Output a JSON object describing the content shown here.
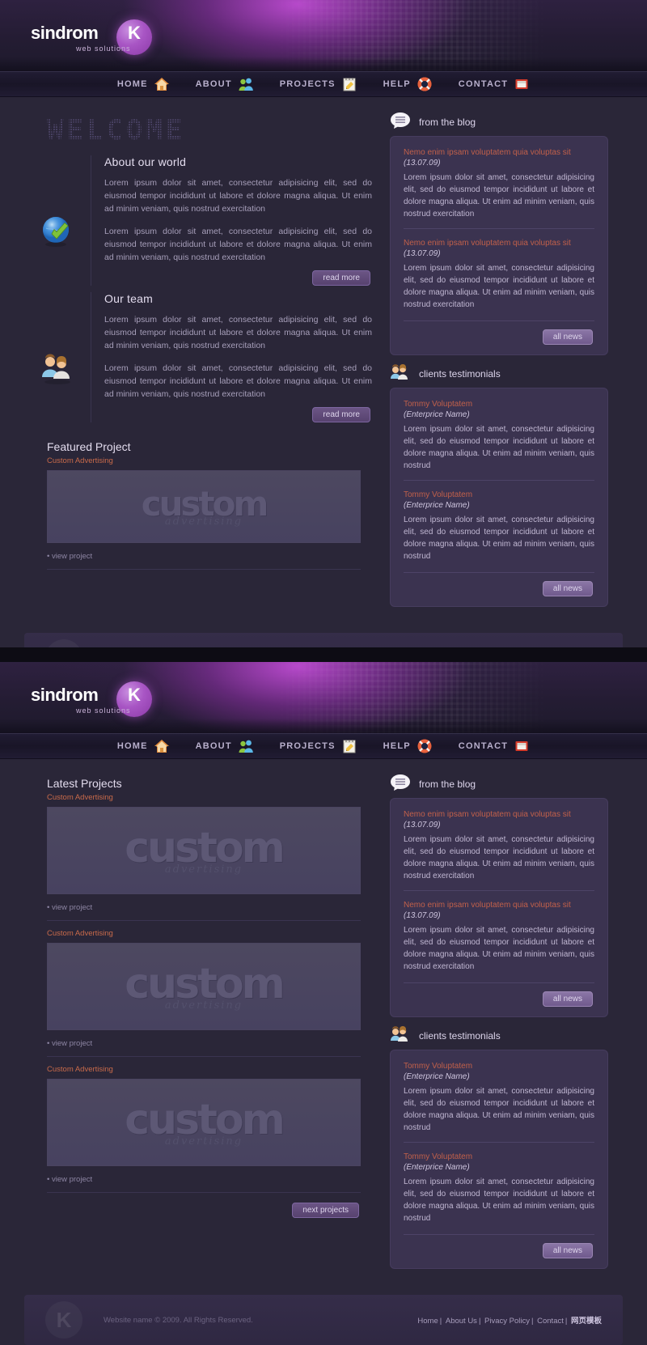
{
  "brand": {
    "name": "sindrom",
    "mark": "K",
    "tagline": "web solutions"
  },
  "nav": [
    {
      "label": "HOME",
      "icon": "house-icon"
    },
    {
      "label": "ABOUT",
      "icon": "users-icon"
    },
    {
      "label": "PROJECTS",
      "icon": "notepad-icon"
    },
    {
      "label": "HELP",
      "icon": "lifebuoy-icon"
    },
    {
      "label": "CONTACT",
      "icon": "mailbox-icon"
    }
  ],
  "home": {
    "welcome_title": "WELCOME",
    "blocks": [
      {
        "icon": "globe-check-icon",
        "heading": "About our world",
        "paragraphs": [
          "Lorem ipsum dolor sit amet, consectetur adipisicing elit, sed do eiusmod tempor incididunt ut labore et dolore magna aliqua. Ut enim ad minim veniam, quis nostrud exercitation",
          "Lorem ipsum dolor sit amet, consectetur adipisicing elit, sed do eiusmod tempor incididunt ut labore et dolore magna aliqua. Ut enim ad minim veniam, quis nostrud exercitation"
        ],
        "button": "read more"
      },
      {
        "icon": "team-icon",
        "heading": "Our team",
        "paragraphs": [
          "Lorem ipsum dolor sit amet, consectetur adipisicing elit, sed do eiusmod tempor incididunt ut labore et dolore magna aliqua. Ut enim ad minim veniam, quis nostrud exercitation",
          "Lorem ipsum dolor sit amet, consectetur adipisicing elit, sed do eiusmod tempor incididunt ut labore et dolore magna aliqua. Ut enim ad minim veniam, quis nostrud exercitation"
        ],
        "button": "read more"
      }
    ],
    "featured": {
      "heading": "Featured Project",
      "caption": "Custom Advertising",
      "thumb_word": "custom",
      "thumb_sub": "advertising",
      "view_link": "• view project"
    }
  },
  "projects_page": {
    "heading": "Latest Projects",
    "items": [
      {
        "caption": "Custom Advertising",
        "thumb_word": "custom",
        "thumb_sub": "advertising",
        "view_link": "• view project"
      },
      {
        "caption": "Custom Advertising",
        "thumb_word": "custom",
        "thumb_sub": "advertising",
        "view_link": "• view project"
      },
      {
        "caption": "Custom Advertising",
        "thumb_word": "custom",
        "thumb_sub": "advertising",
        "view_link": "• view project"
      }
    ],
    "next_button": "next projects"
  },
  "blog": {
    "icon": "speech-bubble-icon",
    "title": "from the blog",
    "posts": [
      {
        "title": "Nemo enim ipsam voluptatem quia voluptas sit",
        "date": "(13.07.09)",
        "body": "Lorem ipsum dolor sit amet, consectetur adipisicing elit, sed do eiusmod tempor incididunt ut labore et dolore magna aliqua. Ut enim ad minim veniam, quis nostrud exercitation"
      },
      {
        "title": "Nemo enim ipsam voluptatem quia voluptas sit",
        "date": "(13.07.09)",
        "body": "Lorem ipsum dolor sit amet, consectetur adipisicing elit, sed do eiusmod tempor incididunt ut labore et dolore magna aliqua. Ut enim ad minim veniam, quis nostrud exercitation"
      }
    ],
    "button": "all news"
  },
  "testimonials": {
    "icon": "clients-icon",
    "title": "clients testimonials",
    "items": [
      {
        "name": "Tommy Voluptatem",
        "company": "(Enterprice Name)",
        "body": "Lorem ipsum dolor sit amet, consectetur adipisicing elit, sed do eiusmod tempor incididunt ut labore et dolore magna aliqua. Ut enim ad minim veniam, quis nostrud"
      },
      {
        "name": "Tommy Voluptatem",
        "company": "(Enterprice Name)",
        "body": "Lorem ipsum dolor sit amet, consectetur adipisicing elit, sed do eiusmod tempor incididunt ut labore et dolore magna aliqua. Ut enim ad minim veniam, quis nostrud"
      }
    ],
    "button": "all news"
  },
  "footer": {
    "mark": "K",
    "copyright": "Website name © 2009. All Rights Reserved.",
    "links": [
      "Home",
      "About Us",
      "Pivacy Policy",
      "Contact"
    ],
    "cn_link": "网页模板"
  },
  "colors": {
    "accent_purple": "#a855c4",
    "panel": "#3b3350",
    "page_bg": "#2a2638",
    "link_orange": "#c1604a"
  }
}
